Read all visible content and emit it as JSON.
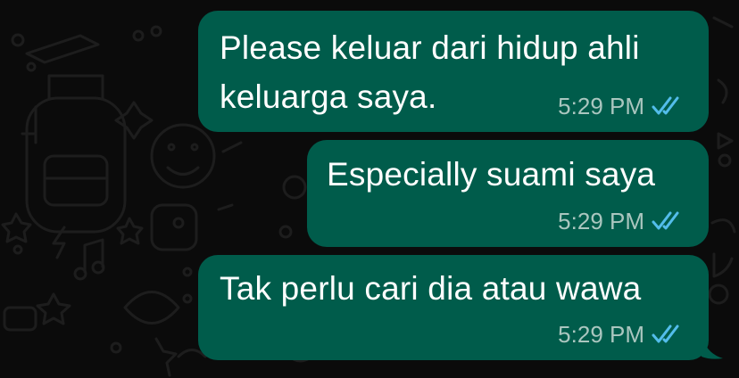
{
  "chat": {
    "messages": [
      {
        "text": "Please keluar dari hidup ahli\nkeluarga saya.",
        "time": "5:29 PM",
        "status_icon": "double-check-read-icon",
        "direction": "outgoing"
      },
      {
        "text": "Especially suami saya",
        "time": "5:29 PM",
        "status_icon": "double-check-read-icon",
        "direction": "outgoing"
      },
      {
        "text": "Tak perlu cari dia atau wawa",
        "time": "5:29 PM",
        "status_icon": "double-check-read-icon",
        "direction": "outgoing"
      }
    ]
  },
  "colors": {
    "background": "#0b0b0b",
    "outgoing_bubble": "#005c4b",
    "message_text": "#ffffff",
    "meta_text": "#aac6bf",
    "read_tick": "#53bdeb",
    "doodle": "#1c1c1c"
  }
}
